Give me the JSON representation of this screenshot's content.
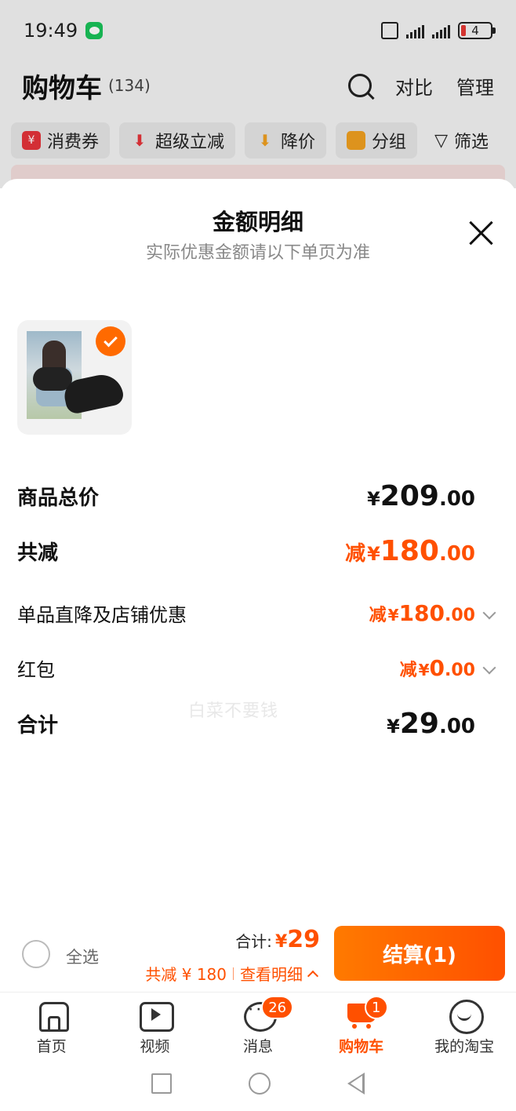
{
  "status_bar": {
    "time": "19:49",
    "battery": "4"
  },
  "header": {
    "title": "购物车",
    "count": "(134)",
    "compare": "对比",
    "manage": "管理"
  },
  "filters": [
    {
      "label": "消费券",
      "icon": "coupon-icon",
      "color": "#e5333a"
    },
    {
      "label": "超级立减",
      "icon": "arrow-down-icon",
      "color": "#e5333a"
    },
    {
      "label": "降价",
      "icon": "price-drop-icon",
      "color": "#f0a020"
    },
    {
      "label": "分组",
      "icon": "folder-icon",
      "color": "#f0a020"
    }
  ],
  "filter_button": "筛选",
  "sheet": {
    "title": "金额明细",
    "subtitle": "实际优惠金额请以下单页为准"
  },
  "breakdown": {
    "total_price": {
      "label": "商品总价",
      "currency": "¥",
      "int": "209",
      "dec": ".00"
    },
    "total_discount": {
      "label": "共减",
      "prefix": "减",
      "currency": "¥",
      "int": "180",
      "dec": ".00"
    },
    "item_discount": {
      "label": "单品直降及店铺优惠",
      "prefix": "减",
      "currency": "¥",
      "int": "180",
      "dec": ".00"
    },
    "red_packet": {
      "label": "红包",
      "prefix": "减",
      "currency": "¥",
      "int": "0",
      "dec": ".00"
    },
    "sum": {
      "label": "合计",
      "currency": "¥",
      "int": "29",
      "dec": ".00"
    }
  },
  "watermark": "白菜不要钱",
  "checkout": {
    "select_all": "全选",
    "total_label": "合计:",
    "total_currency": "¥",
    "total_value": "29",
    "discount_text": "共减 ¥ 180",
    "details_link": "查看明细",
    "button": "结算(1)"
  },
  "tabs": [
    {
      "label": "首页",
      "icon": "home-icon"
    },
    {
      "label": "视频",
      "icon": "video-icon"
    },
    {
      "label": "消息",
      "icon": "message-icon",
      "badge": "26"
    },
    {
      "label": "购物车",
      "icon": "cart-icon",
      "badge": "1",
      "active": true
    },
    {
      "label": "我的淘宝",
      "icon": "profile-icon"
    }
  ],
  "colors": {
    "accent": "#ff5000",
    "check": "#ff6a00"
  }
}
